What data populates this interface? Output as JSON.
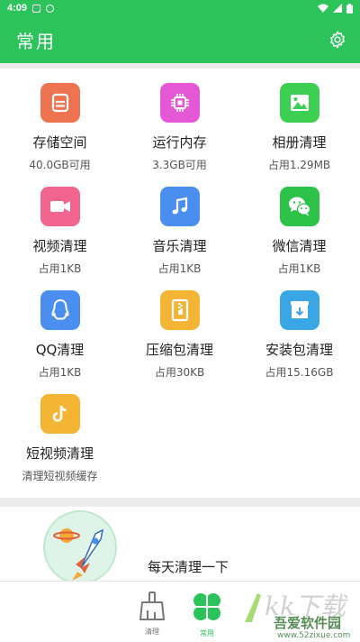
{
  "status_bar": {
    "time": "4:09"
  },
  "header": {
    "title": "常用"
  },
  "tiles": [
    {
      "title": "存储空间",
      "subtitle": "40.0GB可用",
      "color": "#ee7350",
      "icon": "storage-icon"
    },
    {
      "title": "运行内存",
      "subtitle": "3.3GB可用",
      "color": "#e458d6",
      "icon": "memory-chip-icon"
    },
    {
      "title": "相册清理",
      "subtitle": "占用1.29MB",
      "color": "#3ccf52",
      "icon": "photo-album-icon"
    },
    {
      "title": "视频清理",
      "subtitle": "占用1KB",
      "color": "#f1658f",
      "icon": "video-camera-icon"
    },
    {
      "title": "音乐清理",
      "subtitle": "占用1KB",
      "color": "#4a8ef0",
      "icon": "music-note-icon"
    },
    {
      "title": "微信清理",
      "subtitle": "占用1KB",
      "color": "#2dc24a",
      "icon": "wechat-icon"
    },
    {
      "title": "QQ清理",
      "subtitle": "占用1KB",
      "color": "#4a8ef0",
      "icon": "qq-penguin-icon"
    },
    {
      "title": "压缩包清理",
      "subtitle": "占用30KB",
      "color": "#f5b534",
      "icon": "zip-archive-icon"
    },
    {
      "title": "安装包清理",
      "subtitle": "占用15.16GB",
      "color": "#3aa6e6",
      "icon": "install-package-icon"
    },
    {
      "title": "短视频清理",
      "subtitle": "清理短视频缓存",
      "color": "#f5b534",
      "icon": "tiktok-icon"
    }
  ],
  "tip": {
    "text": "每天清理一下",
    "icon": "rocket-icon"
  },
  "bottom_nav": [
    {
      "label": "清理",
      "icon": "broom-icon",
      "active": false
    },
    {
      "label": "常用",
      "icon": "clover-icon",
      "active": true
    }
  ],
  "watermark": {
    "text": "吾爱软件园",
    "url": "www.52zixue.com",
    "logo": "k-watermark-logo"
  },
  "colors": {
    "primary": "#2cc35b",
    "background": "#ececec"
  }
}
